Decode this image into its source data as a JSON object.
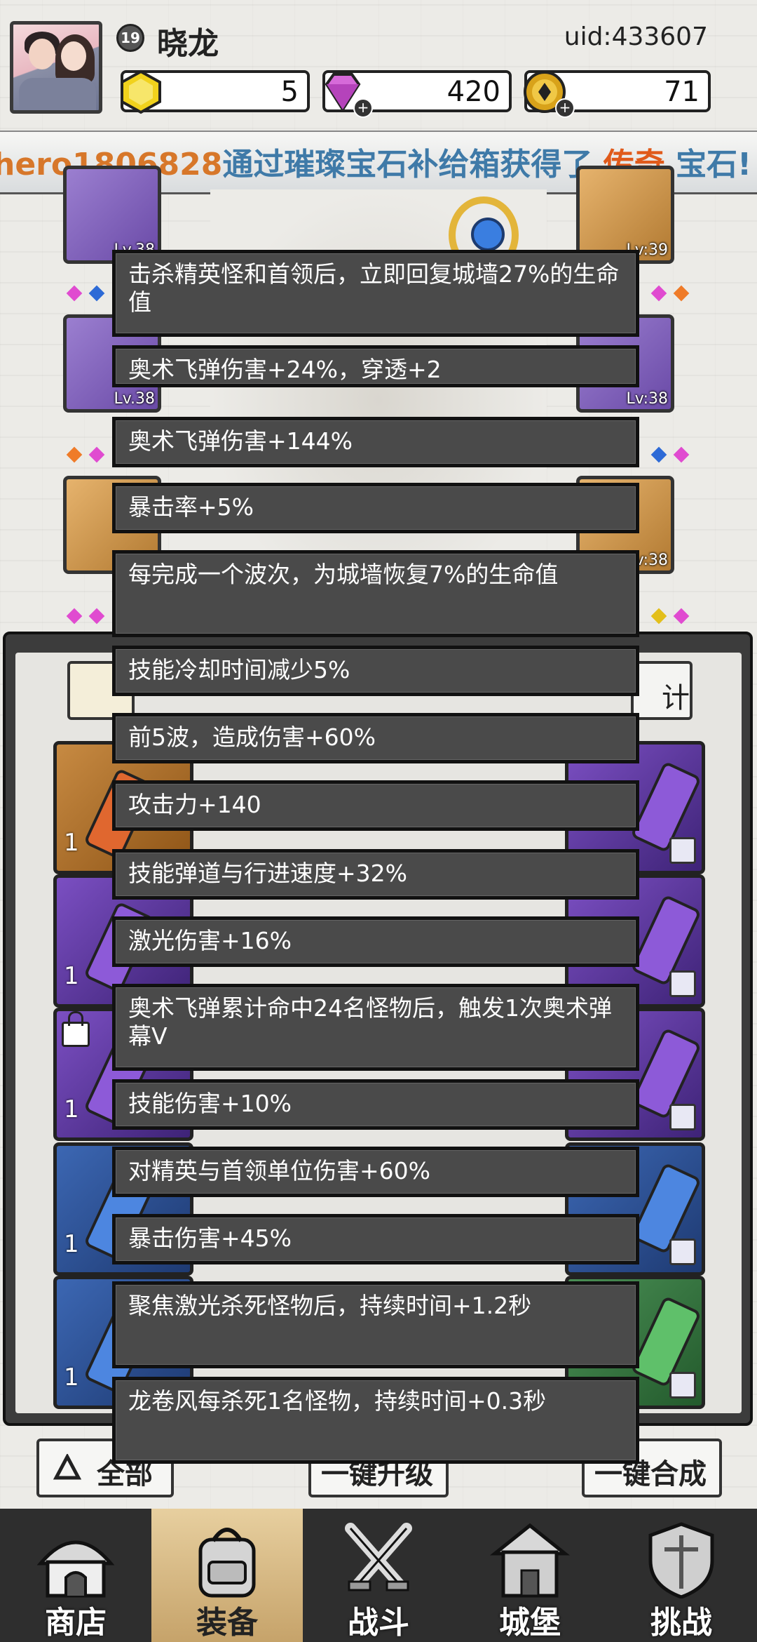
{
  "player": {
    "level": "19",
    "name": "晓龙",
    "uid": "uid:433607"
  },
  "resources": [
    {
      "name": "gold-hexagon",
      "value": "5",
      "color": "#f1d21c"
    },
    {
      "name": "diamond",
      "value": "420",
      "color": "#d66ad9"
    },
    {
      "name": "coin",
      "value": "71",
      "color": "#d8a21a"
    }
  ],
  "banner": {
    "user": "hero1806828",
    "text_before": "通过璀璨宝石补给箱获得了",
    "highlight": "传奇",
    "text_after": "宝石!"
  },
  "equipment_slots": [
    {
      "id": "top-left",
      "rarity": "purple",
      "level": "Lv.38"
    },
    {
      "id": "top-right",
      "rarity": "orange",
      "level": "Lv:39"
    },
    {
      "id": "mid-left",
      "rarity": "purple",
      "level": "Lv.38"
    },
    {
      "id": "mid-right",
      "rarity": "purple",
      "level": "Lv:38"
    },
    {
      "id": "low-left",
      "rarity": "orange",
      "level": ""
    },
    {
      "id": "low-right",
      "rarity": "orange",
      "level": "Lv:38"
    }
  ],
  "tooltip_items": [
    "击杀精英怪和首领后，立即回复城墙27%的生命值",
    "奥术飞弹伤害+24%，穿透+2",
    "奥术飞弹伤害+144%",
    "暴击率+5%",
    "每完成一个波次，为城墙恢复7%的生命值",
    "技能冷却时间减少5%",
    "前5波，造成伤害+60%",
    "攻击力+140",
    "技能弹道与行进速度+32%",
    "激光伤害+16%",
    "奥术飞弹累计命中24名怪物后，触发1次奥术弹幕V",
    "技能伤害+10%",
    "对精英与首领单位伤害+60%",
    "暴击伤害+45%",
    "聚焦激光杀死怪物后，持续时间+1.2秒",
    "龙卷风每杀死1名怪物，持续时间+0.3秒"
  ],
  "panel": {
    "stat_button_label": "计"
  },
  "gem_cards_left_counts": [
    "1",
    "1",
    "1",
    "1",
    "1"
  ],
  "filter_buttons": {
    "all_label": "全部",
    "upgrade_label": "一键升级",
    "merge_label": "一键合成"
  },
  "nav": [
    {
      "label": "商店",
      "icon": "shop-icon"
    },
    {
      "label": "装备",
      "icon": "backpack-icon",
      "active": true
    },
    {
      "label": "战斗",
      "icon": "crossed-swords-icon"
    },
    {
      "label": "城堡",
      "icon": "castle-icon"
    },
    {
      "label": "挑战",
      "icon": "shield-icon"
    }
  ]
}
